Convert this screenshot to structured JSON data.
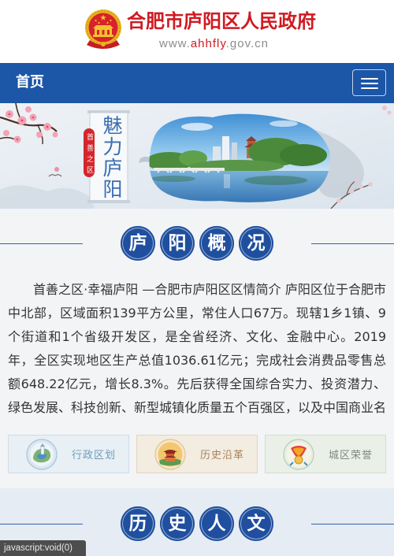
{
  "site": {
    "title": "合肥市庐阳区人民政府",
    "url": {
      "prefix": "www.",
      "highlight": "ahhfly",
      "suffix": ".gov.cn"
    },
    "emblem_icon": "national-emblem-icon",
    "brand_color": "#cf1a22"
  },
  "nav": {
    "home_label": "首页",
    "menu_icon": "hamburger-menu-icon",
    "bar_color": "#1c56a6"
  },
  "banner": {
    "scroll_title": "魅力庐阳",
    "seal_text": "首善之区"
  },
  "overview": {
    "heading_chars": [
      "庐",
      "阳",
      "概",
      "况"
    ],
    "intro_text": "首善之区·幸福庐阳 —合肥市庐阳区区情简介 庐阳区位于合肥市中北部，区域面积139平方公里，常住人口67万。现辖1乡1镇、9个街道和1个省级开发区，是全省经济、文化、金融中心。2019年，全区实现地区生产总值1036.61亿元；完成社会消费品零售总额648.22亿元，增长8.3%。先后获得全国综合实力、投资潜力、绿色发展、科技创新、新型城镇化质量五个百强区，以及中国商业名区、中国最"
  },
  "cards": [
    {
      "label": "行政区划",
      "icon": "district-map-icon",
      "text_color": "#6d9dbb"
    },
    {
      "label": "历史沿革",
      "icon": "pavilion-icon",
      "text_color": "#a9835b"
    },
    {
      "label": "城区荣誉",
      "icon": "honor-ribbon-icon",
      "text_color": "#7e8a83"
    }
  ],
  "culture": {
    "heading_chars": [
      "历",
      "史",
      "人",
      "文"
    ]
  },
  "status_bar": {
    "link_text": "javascript:void(0)"
  },
  "theme": {
    "heading_circle_color": "#1f4f9e"
  }
}
